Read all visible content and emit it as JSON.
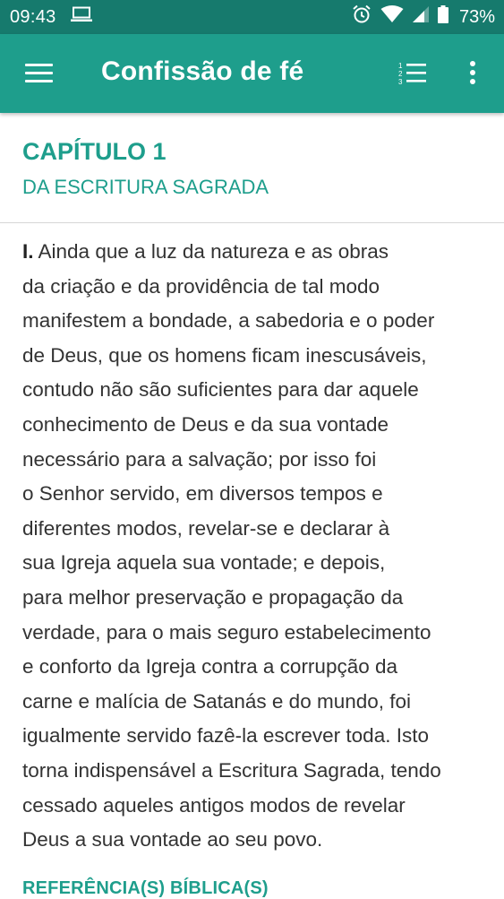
{
  "status_bar": {
    "time": "09:43",
    "battery": "73%",
    "icons": [
      "laptop-icon",
      "alarm-icon",
      "wifi-icon",
      "signal-icon",
      "battery-icon"
    ]
  },
  "app_bar": {
    "title": "Confissão de fé",
    "menu_icon": "hamburger-menu-icon",
    "toc_icon": "numbered-list-icon",
    "overflow_icon": "more-vert-icon"
  },
  "chapter": {
    "title": "CAPÍTULO 1",
    "subtitle": "DA ESCRITURA SAGRADA"
  },
  "article": {
    "number": "I.",
    "lines": [
      " Ainda que a luz da natureza e as obras",
      "da criação e da providência de tal modo",
      "manifestem a bondade, a sabedoria e o poder",
      "de Deus, que os homens ficam inescusáveis,",
      "contudo não são suficientes para dar aquele",
      "conhecimento de Deus e da sua vontade",
      "necessário para a salvação; por isso foi",
      "o Senhor servido, em diversos tempos e",
      "diferentes modos, revelar-se e declarar à",
      "sua Igreja aquela sua vontade; e depois,",
      "para melhor preservação e propagação da",
      "verdade, para o mais seguro estabelecimento",
      "e conforto da Igreja contra a corrupção da",
      "carne e malícia de Satanás e do mundo, foi",
      "igualmente servido fazê-la escrever toda. Isto",
      "torna indispensável a Escritura Sagrada, tendo",
      "cessado aqueles antigos modos de revelar",
      "Deus a sua vontade ao seu povo."
    ]
  },
  "references": {
    "heading": "REFERÊNCIA(S) BÍBLICA(S)"
  },
  "colors": {
    "status_bar": "#167a6d",
    "app_bar": "#1e9e8c",
    "accent": "#1e9e8c",
    "body_text": "#333333"
  }
}
